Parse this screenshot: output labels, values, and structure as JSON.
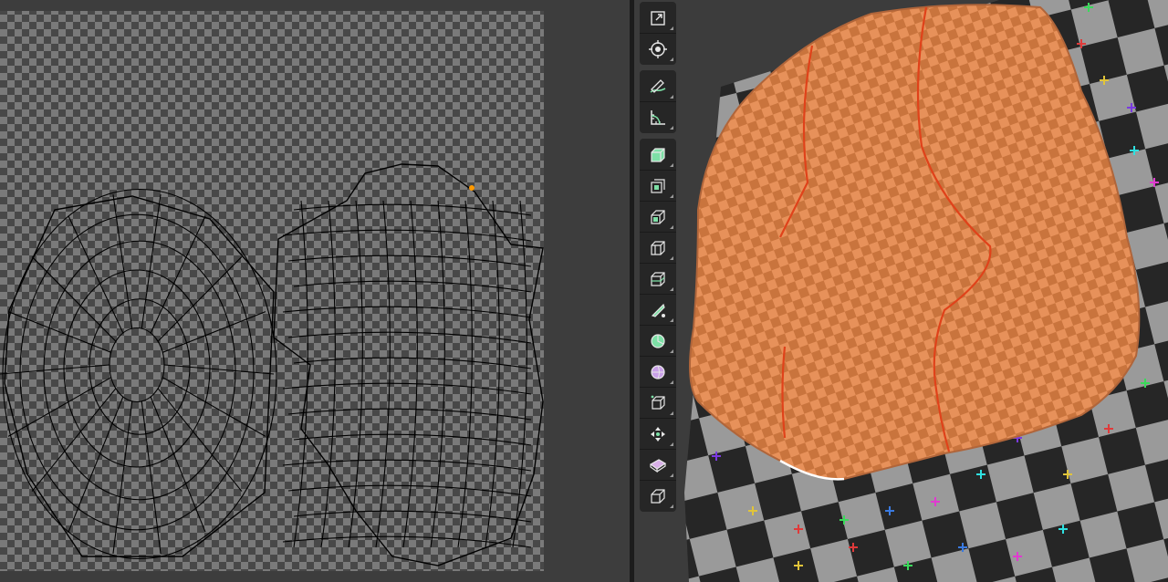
{
  "uv_editor": {
    "checker_colors": {
      "light": "#7a7a7a",
      "dark": "#484848",
      "background": "#3d3d3d"
    },
    "wire_color": "#000000",
    "wire_highlight_color": "#ffffff",
    "selected_vertex_color": "#ff9a00"
  },
  "viewport": {
    "background": "#3c3c3c",
    "mesh_color": "#e7915a",
    "mesh_checker_dark": "#c9743d",
    "seam_color": "#e0421a",
    "plane_checker": {
      "light": "#9a9a9a",
      "dark": "#262626"
    },
    "marker_colors": [
      "#3ad95a",
      "#e03a3a",
      "#e0c43a",
      "#7a3ae0",
      "#2fe0e0",
      "#e03ad0",
      "#3a7ae0"
    ]
  },
  "toolbar": {
    "tools": [
      {
        "id": "scale-cage",
        "icon": "scale-cage-icon",
        "group": 0
      },
      {
        "id": "transform",
        "icon": "transform-icon",
        "group": 0
      },
      {
        "id": "annotate",
        "icon": "annotate-icon",
        "group": 1
      },
      {
        "id": "measure",
        "icon": "measure-icon",
        "group": 1
      },
      {
        "id": "add-cube",
        "icon": "add-cube-icon",
        "group": 2
      },
      {
        "id": "extrude-region",
        "icon": "extrude-region-icon",
        "group": 2
      },
      {
        "id": "inset-faces",
        "icon": "inset-faces-icon",
        "group": 2
      },
      {
        "id": "bevel",
        "icon": "bevel-icon",
        "group": 2
      },
      {
        "id": "loop-cut",
        "icon": "loop-cut-icon",
        "group": 2
      },
      {
        "id": "knife",
        "icon": "knife-icon",
        "group": 2
      },
      {
        "id": "poly-build",
        "icon": "poly-build-icon",
        "group": 2
      },
      {
        "id": "spin",
        "icon": "spin-icon",
        "group": 2
      },
      {
        "id": "smooth",
        "icon": "smooth-icon",
        "group": 2
      },
      {
        "id": "edge-slide",
        "icon": "edge-slide-icon",
        "group": 2
      },
      {
        "id": "shrink-fatten",
        "icon": "shrink-fatten-icon",
        "group": 2
      },
      {
        "id": "shear",
        "icon": "shear-icon",
        "group": 2
      },
      {
        "id": "rip-region",
        "icon": "rip-region-icon",
        "group": 2
      }
    ]
  }
}
